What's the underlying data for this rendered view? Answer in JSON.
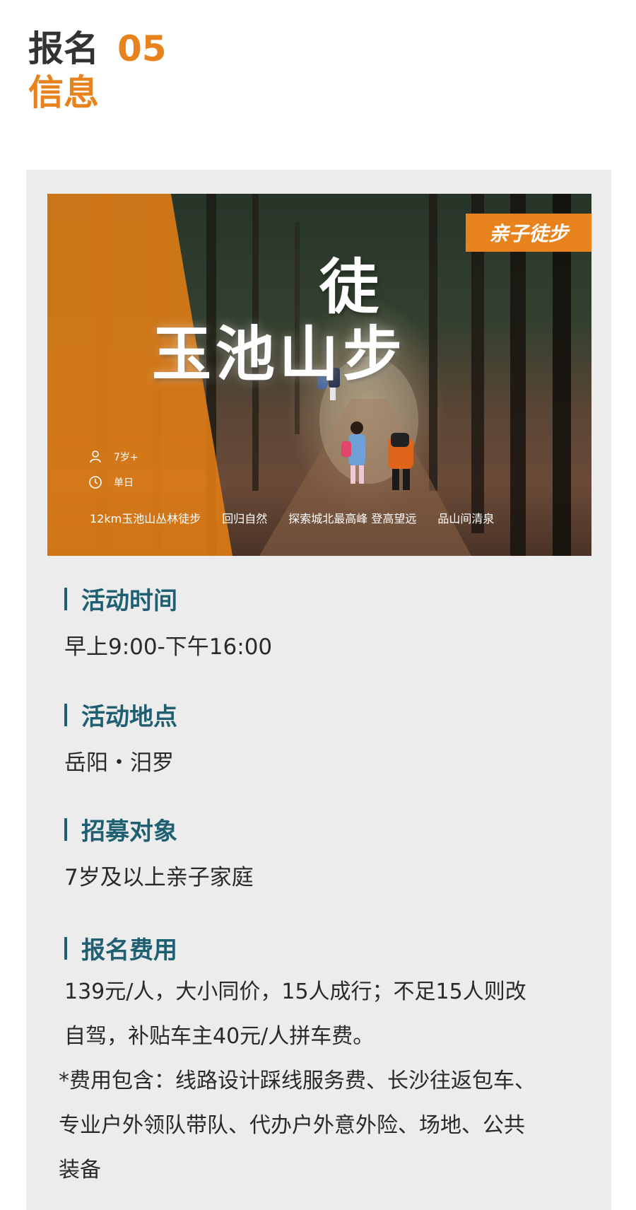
{
  "header": {
    "word1": "报名",
    "number": "05",
    "word2": "信息"
  },
  "banner": {
    "tag": "亲子徒步",
    "title_main": "玉池山步",
    "title_raised": "徒",
    "age": "7岁+",
    "duration": "单日",
    "features": [
      "12km玉池山丛林徒步",
      "回归自然",
      "探索城北最高峰 登高望远",
      "品山间清泉"
    ]
  },
  "sections": {
    "time": {
      "title": "活动时间",
      "body": "早上9:00-下午16:00"
    },
    "place": {
      "title": "活动地点",
      "body": "岳阳・汨罗"
    },
    "target": {
      "title": "招募对象",
      "body": "7岁及以上亲子家庭"
    },
    "fee": {
      "title": "报名费用",
      "line1": "139元/人，大小同价，15人成行；不足15人则改",
      "line2": "自驾，补贴车主40元/人拼车费。",
      "inc1": "*费用包含：线路设计踩线服务费、长沙往返包车、",
      "inc2": "专业户外领队带队、代办户外意外险、场地、公共",
      "inc3": "装备"
    }
  },
  "colors": {
    "accent_orange": "#e8821c",
    "section_teal": "#1f5f72",
    "card_bg": "#ececec"
  },
  "icons": [
    "person-icon",
    "clock-icon"
  ]
}
